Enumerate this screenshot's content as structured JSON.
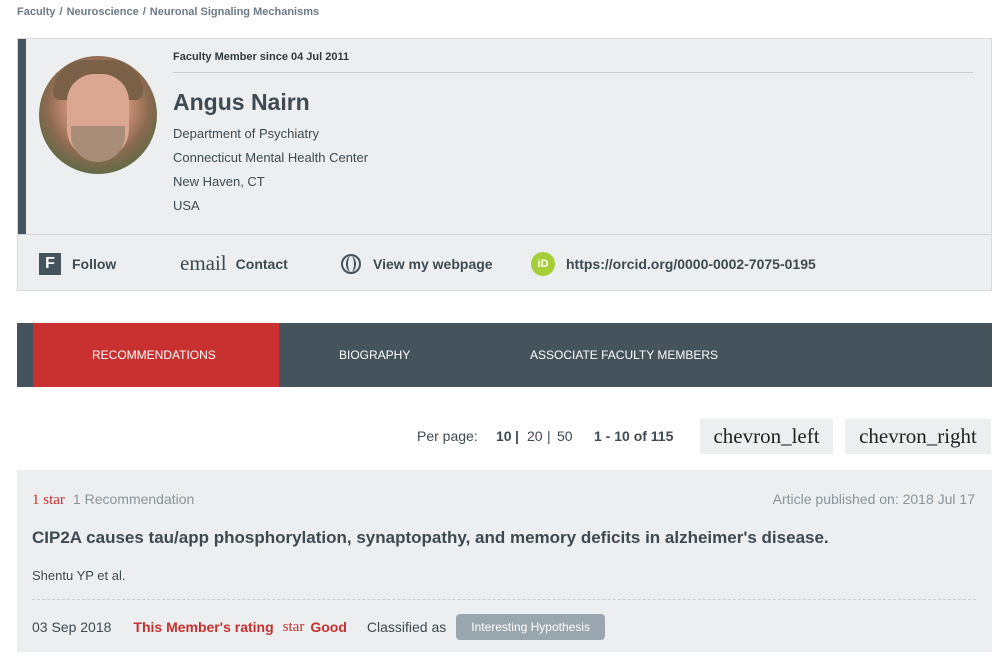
{
  "breadcrumb": [
    "Faculty",
    "Neuroscience",
    "Neuronal Signaling Mechanisms"
  ],
  "profile": {
    "member_since": "Faculty Member since 04 Jul 2011",
    "name": "Angus Nairn",
    "department": "Department of Psychiatry",
    "institution": "Connecticut Mental Health Center",
    "city": "New Haven, CT",
    "country": "USA"
  },
  "actions": {
    "follow_icon": "F",
    "follow": "Follow",
    "email_icon_text": "email",
    "contact": "Contact",
    "webpage": "View my webpage",
    "orcid_icon": "iD",
    "orcid_url": "https://orcid.org/0000-0002-7075-0195"
  },
  "tabs": [
    {
      "label": "RECOMMENDATIONS",
      "active": true
    },
    {
      "label": "BIOGRAPHY",
      "active": false
    },
    {
      "label": "ASSOCIATE FACULTY MEMBERS",
      "active": false
    }
  ],
  "pagination": {
    "per_page_label": "Per page:",
    "options": [
      "10",
      "20",
      "50"
    ],
    "selected": "10",
    "range": "1 - 10 of 115",
    "prev_label": "chevron_left",
    "next_label": "chevron_right"
  },
  "recommendation": {
    "star_label": "1 star",
    "count": "1 Recommendation",
    "published": "Article published on: 2018 Jul 17",
    "title": "CIP2A causes tau/app phosphorylation, synaptopathy, and memory deficits in alzheimer's disease.",
    "authors": "Shentu YP et al.",
    "date": "03 Sep 2018",
    "member_rating_label": "This Member's rating",
    "star_icon_text": "star",
    "rating_value": "Good",
    "classified_label": "Classified as",
    "classification": "Interesting Hypothesis"
  },
  "colors": {
    "accent": "#c8312f",
    "header_bar": "#45535c",
    "orcid": "#a6ce39",
    "card_bg": "#eceeef"
  }
}
